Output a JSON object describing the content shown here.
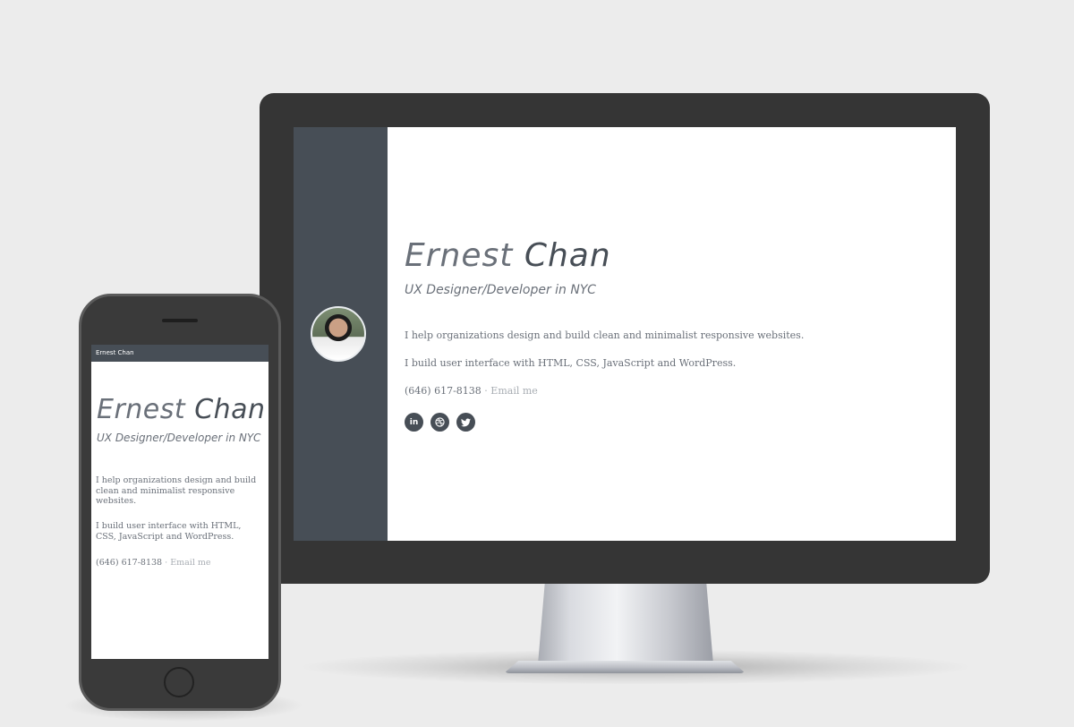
{
  "profile": {
    "first_name": "Ernest",
    "last_name": "Chan",
    "tagline": "UX Designer/Developer in NYC",
    "intro_1": "I help organizations design and build clean and minimalist responsive websites.",
    "intro_2": "I build user interface with HTML, CSS, JavaScript and WordPress.",
    "phone": "(646) 617-8138",
    "separator": "·",
    "email_label": "Email me"
  },
  "social": [
    {
      "name": "linkedin",
      "icon": "linkedin-icon",
      "glyph": "in"
    },
    {
      "name": "dribbble",
      "icon": "dribbble-icon"
    },
    {
      "name": "twitter",
      "icon": "twitter-icon"
    }
  ],
  "mobile": {
    "nav_title": "Ernest Chan"
  },
  "colors": {
    "sidebar": "#474e56",
    "text": "#6a7079",
    "muted": "#a8adb3",
    "device_frame": "#353535"
  }
}
